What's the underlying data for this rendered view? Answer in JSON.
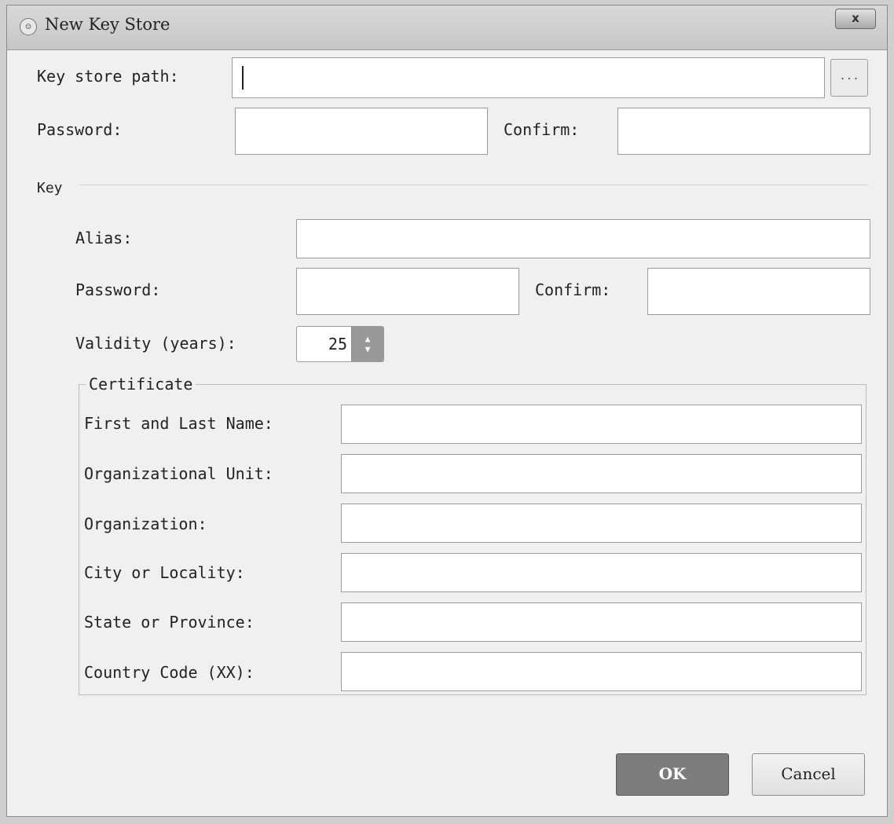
{
  "window": {
    "title": "New Key Store",
    "app_icon": "android-studio-icon",
    "close_label": "x"
  },
  "keystore": {
    "path_label": "Key store path:",
    "path_value": "",
    "browse_label": "...",
    "password_label": "Password:",
    "password_value": "",
    "confirm_label": "Confirm:",
    "confirm_value": ""
  },
  "key": {
    "section_label": "Key",
    "alias_label": "Alias:",
    "alias_value": "",
    "password_label": "Password:",
    "password_value": "",
    "confirm_label": "Confirm:",
    "confirm_value": "",
    "validity_label": "Validity (years):",
    "validity_value": "25"
  },
  "certificate": {
    "group_label": "Certificate",
    "first_last_name_label": "First and Last Name:",
    "first_last_name_value": "",
    "org_unit_label": "Organizational Unit:",
    "org_unit_value": "",
    "organization_label": "Organization:",
    "organization_value": "",
    "city_label": "City or Locality:",
    "city_value": "",
    "state_label": "State or Province:",
    "state_value": "",
    "country_label": "Country Code (XX):",
    "country_value": ""
  },
  "buttons": {
    "ok_label": "OK",
    "cancel_label": "Cancel"
  }
}
